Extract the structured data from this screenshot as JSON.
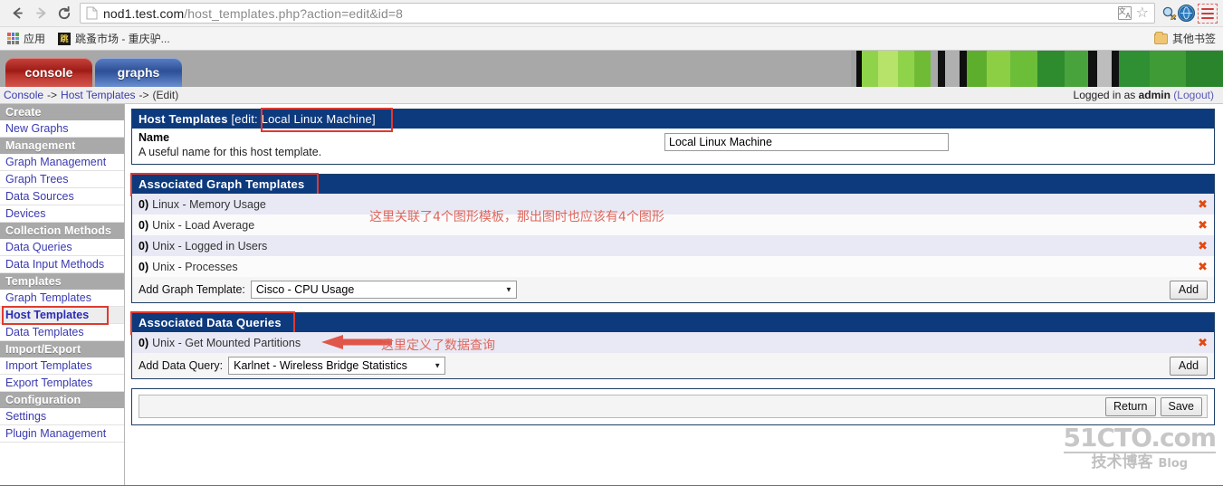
{
  "browser": {
    "back_icon": "back-arrow-icon",
    "forward_icon": "forward-arrow-icon",
    "reload_icon": "reload-icon",
    "url_host": "nod1.test.com",
    "url_path": "/host_templates.php?action=edit&id=8",
    "translate_icon": "translate-icon",
    "bookmark_star_icon": "star-icon",
    "extension_icons": [
      "magnifier-pencil-extension-icon",
      "blue-globe-extension-icon"
    ],
    "menu_icon": "hamburger-menu-icon",
    "bookmarks": {
      "apps_label": "应用",
      "items": [
        {
          "label": "跳蚤市场 - 重庆驴...",
          "favicon": "site-favicon"
        }
      ],
      "other_bookmarks_label": "其他书签",
      "folder_icon": "folder-icon"
    }
  },
  "cacti": {
    "tabs": [
      {
        "id": "console",
        "label": "console",
        "color": "#9e1b16"
      },
      {
        "id": "graphs",
        "label": "graphs",
        "color": "#2d4f96"
      }
    ],
    "breadcrumb": {
      "items": [
        "Console",
        "Host Templates"
      ],
      "separator": "->",
      "current": "(Edit)"
    },
    "session": {
      "prefix": "Logged in as",
      "user": "admin",
      "logout_label": "(Logout)"
    },
    "sidebar": [
      {
        "type": "header",
        "label": "Create"
      },
      {
        "type": "link",
        "label": "New Graphs",
        "active": false
      },
      {
        "type": "header",
        "label": "Management"
      },
      {
        "type": "link",
        "label": "Graph Management",
        "active": false
      },
      {
        "type": "link",
        "label": "Graph Trees",
        "active": false
      },
      {
        "type": "link",
        "label": "Data Sources",
        "active": false
      },
      {
        "type": "link",
        "label": "Devices",
        "active": false
      },
      {
        "type": "header",
        "label": "Collection Methods"
      },
      {
        "type": "link",
        "label": "Data Queries",
        "active": false
      },
      {
        "type": "link",
        "label": "Data Input Methods",
        "active": false
      },
      {
        "type": "header",
        "label": "Templates"
      },
      {
        "type": "link",
        "label": "Graph Templates",
        "active": false
      },
      {
        "type": "link",
        "label": "Host Templates",
        "active": true
      },
      {
        "type": "link",
        "label": "Data Templates",
        "active": false
      },
      {
        "type": "header",
        "label": "Import/Export"
      },
      {
        "type": "link",
        "label": "Import Templates",
        "active": false
      },
      {
        "type": "link",
        "label": "Export Templates",
        "active": false
      },
      {
        "type": "header",
        "label": "Configuration"
      },
      {
        "type": "link",
        "label": "Settings",
        "active": false
      },
      {
        "type": "link",
        "label": "Plugin Management",
        "active": false
      }
    ],
    "host_template_panel": {
      "title_main": "Host Templates",
      "title_edit": "[edit: Local Linux Machine]",
      "name_label": "Name",
      "name_desc": "A useful name for this host template.",
      "name_value": "Local Linux Machine"
    },
    "graph_templates_panel": {
      "title": "Associated Graph Templates",
      "items": [
        {
          "index": "0)",
          "name": "Linux - Memory Usage"
        },
        {
          "index": "0)",
          "name": "Unix - Load Average"
        },
        {
          "index": "0)",
          "name": "Unix - Logged in Users"
        },
        {
          "index": "0)",
          "name": "Unix - Processes"
        }
      ],
      "add_label": "Add Graph Template:",
      "add_selected": "Cisco - CPU Usage",
      "add_button": "Add",
      "delete_icon": "delete-x-icon"
    },
    "data_queries_panel": {
      "title": "Associated Data Queries",
      "items": [
        {
          "index": "0)",
          "name": "Unix - Get Mounted Partitions"
        }
      ],
      "add_label": "Add Data Query:",
      "add_selected": "Karlnet - Wireless Bridge Statistics",
      "add_button": "Add",
      "delete_icon": "delete-x-icon"
    },
    "actions": {
      "return_label": "Return",
      "save_label": "Save"
    },
    "annotations": [
      {
        "id": "graph-templates-note",
        "text": "这里关联了4个图形模板，那出图时也应该有4个图形",
        "color": "#e0675c"
      },
      {
        "id": "data-queries-note",
        "text": "这里定义了数据查询",
        "color": "#e0675c"
      }
    ],
    "highlight_color": "#e03a2f",
    "watermark": {
      "top": "51CTO.com",
      "bottom_cn": "技术博客",
      "bottom_en": "Blog"
    }
  }
}
